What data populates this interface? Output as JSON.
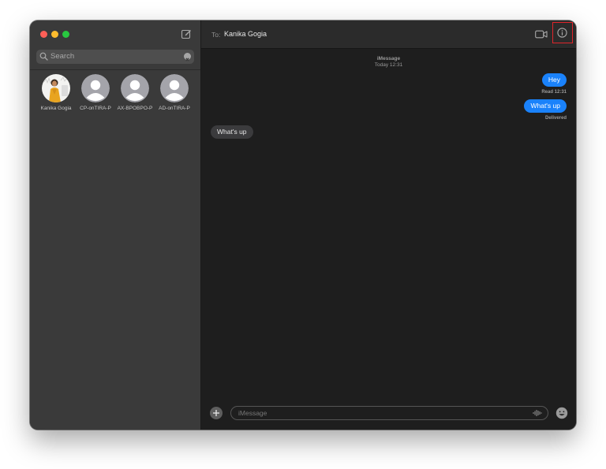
{
  "sidebar": {
    "search": {
      "placeholder": "Search"
    },
    "pinned": [
      {
        "name": "Kanika Gogia",
        "avatar": "photo"
      },
      {
        "name": "CP-onTIRA-P",
        "avatar": "person-icon"
      },
      {
        "name": "AX-BPOBPO-P",
        "avatar": "person-icon"
      },
      {
        "name": "AD-onTIRA-P",
        "avatar": "person-icon"
      }
    ]
  },
  "header": {
    "to_label": "To:",
    "recipient": "Kanika Gogia",
    "highlight_color": "#e0252b"
  },
  "conversation": {
    "service": "iMessage",
    "timestamp": "Today 12:31",
    "messages": [
      {
        "text": "Hey",
        "direction": "outgoing",
        "receipt": "Read 12:31"
      },
      {
        "text": "What's up",
        "direction": "outgoing",
        "receipt": "Delivered"
      },
      {
        "text": "What's up",
        "direction": "incoming"
      }
    ]
  },
  "composer": {
    "placeholder": "iMessage"
  },
  "colors": {
    "outgoing_bubble": "#1a82fb",
    "incoming_bubble": "#3b3b3d",
    "sidebar_bg": "#3a3a3a",
    "main_bg": "#1e1e1e"
  }
}
